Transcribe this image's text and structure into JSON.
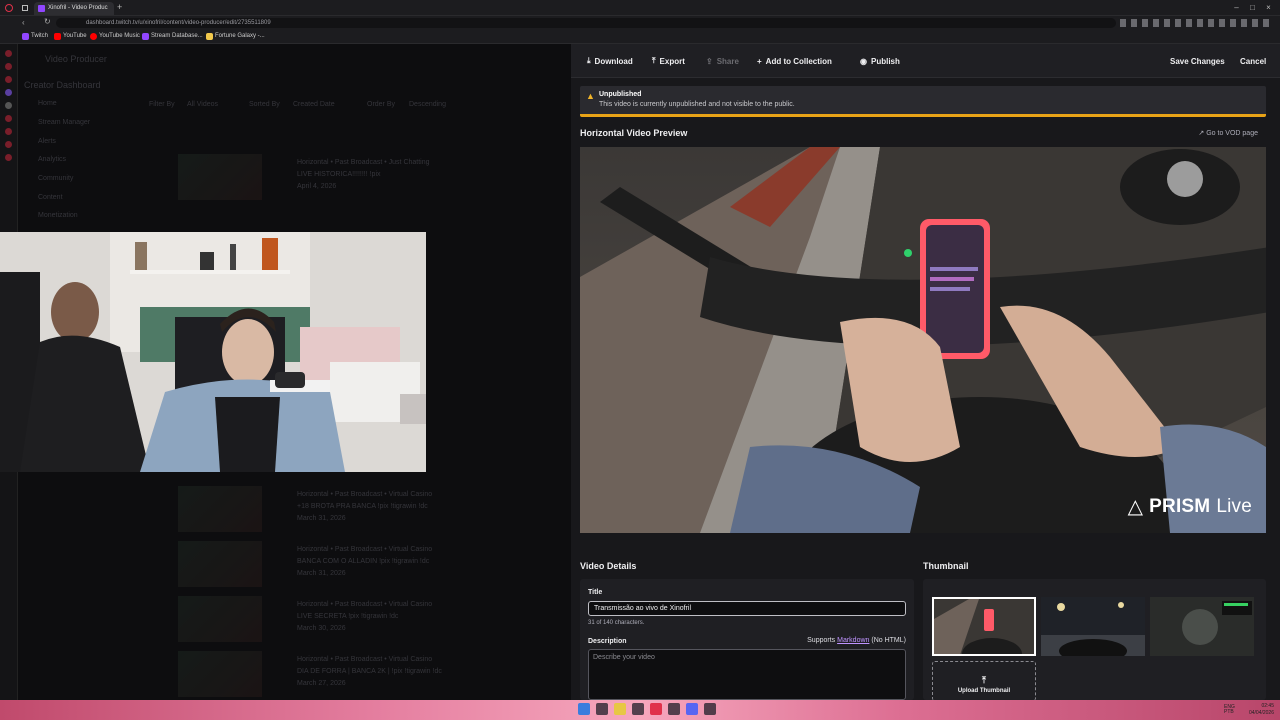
{
  "browser": {
    "tab_title": "Xinofril - Video Produc",
    "url": "dashboard.twitch.tv/u/xinofril/content/video-producer/edit/2735511809",
    "bookmarks": [
      {
        "label": "Twitch",
        "color": "#9146ff"
      },
      {
        "label": "YouTube",
        "color": "#ff0000"
      },
      {
        "label": "YouTube Music",
        "color": "#ff0000"
      },
      {
        "label": "Stream Database...",
        "color": "#9146ff"
      },
      {
        "label": "Fortune Galaxy -...",
        "color": "#f2c94c"
      }
    ]
  },
  "dashboard": {
    "page_title": "Video Producer",
    "section": "Creator Dashboard",
    "nav": [
      "Home",
      "Stream Manager",
      "Alerts",
      "Analytics",
      "Community",
      "Content",
      "Monetization"
    ],
    "filters": [
      "Filter By",
      "All Videos",
      "Sorted By",
      "Created Date",
      "Order By",
      "Descending"
    ],
    "rows": [
      {
        "meta": "Horizontal • Past Broadcast • Just Chatting",
        "title": "LIVE HISTORICA!!!!!!!! !pix",
        "date": "April 4, 2026"
      },
      {
        "meta": "Horizontal • Past Broadcast • Virtual Casino",
        "title": "+18 BROTA PRA BANCA !pix !tigrawin !dc",
        "date": "March 31, 2026"
      },
      {
        "meta": "Horizontal • Past Broadcast • Virtual Casino",
        "title": "BANCA COM O ALLADIN !pix !tigrawin !dc",
        "date": "March 31, 2026"
      },
      {
        "meta": "Horizontal • Past Broadcast • Virtual Casino",
        "title": "LIVE SECRETA !pix !tigrawin !dc",
        "date": "March 30, 2026"
      },
      {
        "meta": "Horizontal • Past Broadcast • Virtual Casino",
        "title": "DIA DE FORRA | BANCA 2K | !pix !tigrawin !dc",
        "date": "March 27, 2026"
      }
    ]
  },
  "toolbar": {
    "download": "Download",
    "export": "Export",
    "share": "Share",
    "add_to_collection": "Add to Collection",
    "publish": "Publish",
    "save_changes": "Save Changes",
    "cancel": "Cancel"
  },
  "notice": {
    "title": "Unpublished",
    "message": "This video is currently unpublished and not visible to the public."
  },
  "preview": {
    "heading": "Horizontal Video Preview",
    "go_to_vod": "Go to VOD page",
    "watermark_bold": "PRISM",
    "watermark_light": "Live"
  },
  "details": {
    "heading": "Video Details",
    "title_label": "Title",
    "title_value": "Transmissão ao vivo de Xinofril",
    "char_count": "31 of 140 characters.",
    "description_label": "Description",
    "supports_prefix": "Supports",
    "markdown_link": "Markdown",
    "supports_suffix": "(No HTML)",
    "description_placeholder": "Describe your video"
  },
  "thumbnail": {
    "heading": "Thumbnail",
    "upload_label": "Upload Thumbnail"
  },
  "tray": {
    "lang": "ENG PTB",
    "time": "02:45",
    "date": "04/04/2026"
  },
  "colors": {
    "accent": "#9146ff",
    "warning": "#e8a317",
    "link": "#bf94ff"
  }
}
